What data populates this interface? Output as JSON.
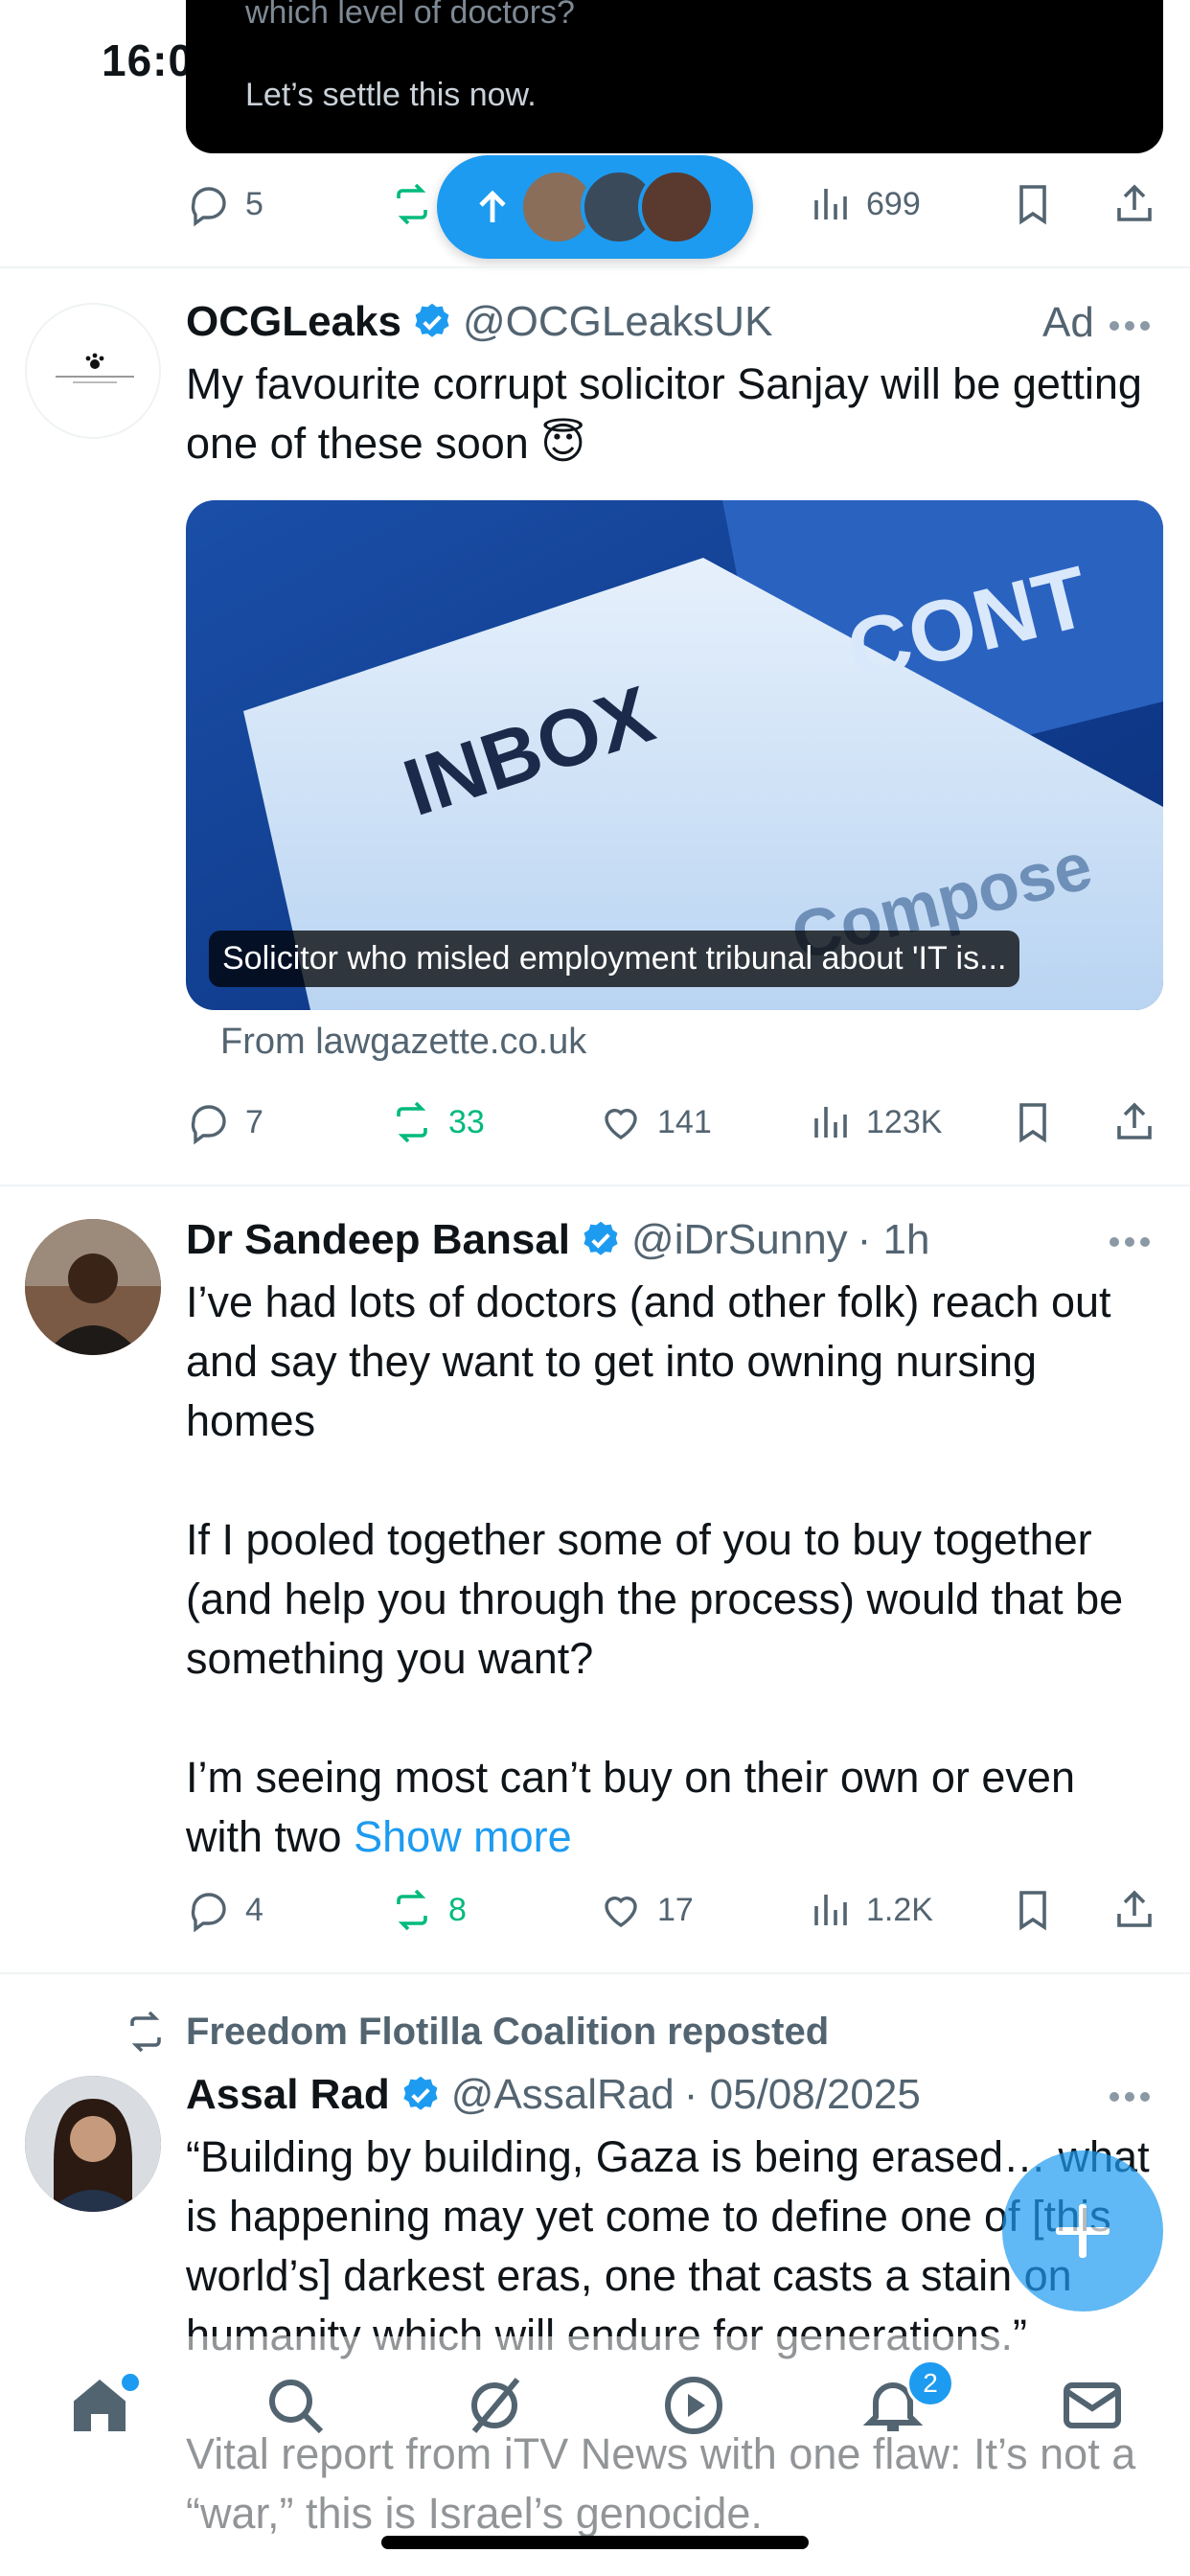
{
  "status_bar": {
    "time": "16:0"
  },
  "tooltip": {
    "line1": "which level of doctors?",
    "line2": "Let’s settle this now."
  },
  "colors": {
    "accent": "#1d9bf0",
    "repost_green": "#00ba7c",
    "text": "#0f1419",
    "muted": "#536471"
  },
  "tweet0": {
    "actions": {
      "replies": "5",
      "views": "699"
    }
  },
  "new_posts_pill": {
    "icon": "arrow-up-icon",
    "avatars": 3
  },
  "tweet1": {
    "name": "OCGLeaks",
    "handle": "@OCGLeaksUK",
    "ad_label": "Ad",
    "text": "My favourite corrupt solicitor Sanjay will be getting one of these soon 😇",
    "card": {
      "caption": "Solicitor who misled employment tribunal about 'IT is...",
      "from": "From lawgazette.co.uk",
      "image_words": {
        "main": "INBOX",
        "corner": "CONT",
        "under": "Compose"
      }
    },
    "actions": {
      "replies": "7",
      "reposts": "33",
      "likes": "141",
      "views": "123K"
    }
  },
  "tweet2": {
    "name": "Dr Sandeep Bansal",
    "handle": "@iDrSunny",
    "time": "· 1h",
    "text": "I’ve had lots of doctors (and other folk) reach out and say they want to get into owning nursing homes\n\nIf I pooled together some of you to buy together (and help you through the process) would that be something you want?\n\nI’m seeing most can’t buy on their own or even with two ",
    "show_more": "Show more",
    "actions": {
      "replies": "4",
      "reposts": "8",
      "likes": "17",
      "views": "1.2K"
    }
  },
  "tweet3": {
    "reposted_by": "Freedom Flotilla Coalition reposted",
    "name": "Assal Rad",
    "handle": "@AssalRad",
    "time": "· 05/08/2025",
    "text": "“Building by building, Gaza is being erased… what is happening may yet come to define one of [this world’s] darkest eras, one that casts a stain on humanity which will endure for generations.”\n\nVital report from iTV News with one flaw: It’s not a “war,” this is Israel’s genocide."
  },
  "bottom_nav": {
    "items": [
      "home-icon",
      "search-icon",
      "grok-icon",
      "video-icon",
      "notifications-icon",
      "messages-icon"
    ],
    "notifications_badge": "2"
  }
}
